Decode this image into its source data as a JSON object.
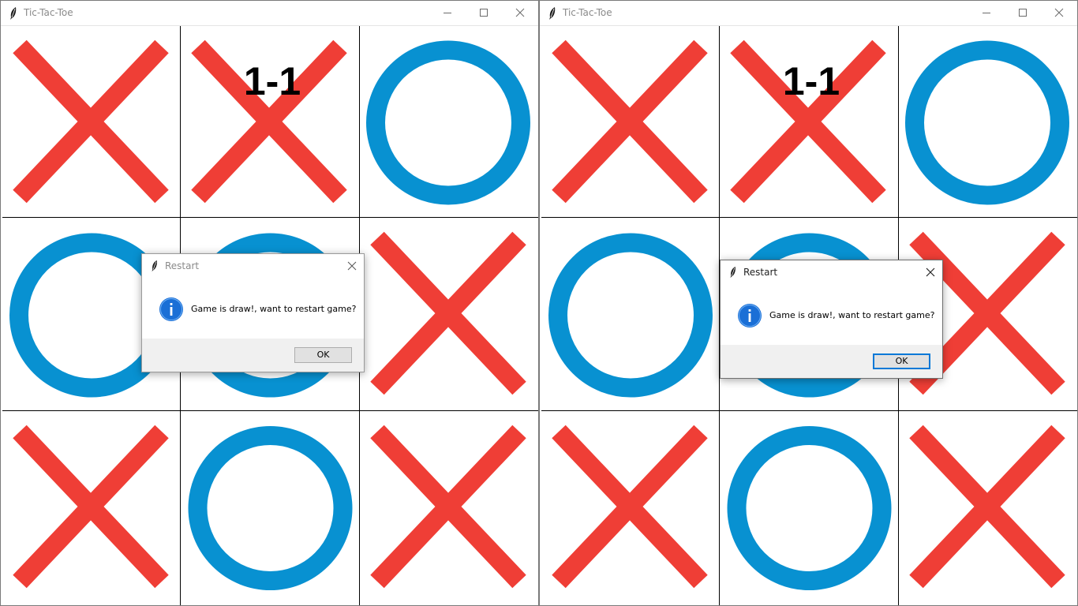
{
  "colors": {
    "x_mark": "#ef3e36",
    "o_mark": "#0891d1",
    "grid": "#000000",
    "info_icon": "#1a6fd6"
  },
  "windows": [
    {
      "title": "Tic-Tac-Toe",
      "title_icon": "feather-icon",
      "controls": [
        "minimize-icon",
        "maximize-icon",
        "close-icon"
      ],
      "score": "1-1",
      "board": [
        [
          "X",
          "X",
          "O"
        ],
        [
          "O",
          "O",
          "X"
        ],
        [
          "X",
          "O",
          "X"
        ]
      ],
      "dialog": {
        "title": "Restart",
        "message": "Game is draw!, want to restart game?",
        "ok_label": "OK",
        "icon": "info-icon",
        "active": false
      }
    },
    {
      "title": "Tic-Tac-Toe",
      "title_icon": "feather-icon",
      "controls": [
        "minimize-icon",
        "maximize-icon",
        "close-icon"
      ],
      "score": "1-1",
      "board": [
        [
          "X",
          "X",
          "O"
        ],
        [
          "O",
          "O",
          "X"
        ],
        [
          "X",
          "O",
          "X"
        ]
      ],
      "dialog": {
        "title": "Restart",
        "message": "Game is draw!, want to restart game?",
        "ok_label": "OK",
        "icon": "info-icon",
        "active": true
      }
    }
  ]
}
